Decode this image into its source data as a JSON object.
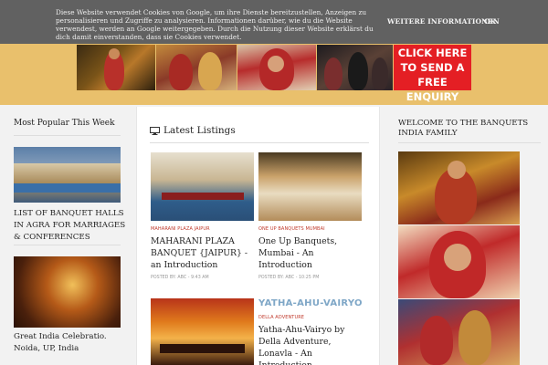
{
  "cookie": {
    "text": "Diese Website verwendet Cookies von Google, um ihre Dienste bereitzustellen, Anzeigen zu personalisieren und Zugriffe zu analysieren. Informationen darüber, wie du die Website verwendest, werden an Google weitergegeben. Durch die Nutzung dieser Website erklärst du dich damit einverstanden, dass sie Cookies verwendet.",
    "more_label": "WEITERE INFORMATIONEN",
    "ok_label": "OK"
  },
  "banner": {
    "enquiry_lines": [
      "CLICK HERE",
      "TO SEND A",
      "FREE ENQUIRY"
    ]
  },
  "left": {
    "title": "Most Popular This Week",
    "items": [
      {
        "title": "LIST OF BANQUET HALLS IN AGRA FOR MARRIAGES & CONFERENCES"
      },
      {
        "title": "Great India Celebratio. Noida, UP, India"
      }
    ]
  },
  "main": {
    "title": "Latest Listings",
    "listings": [
      {
        "category": "MAHARANI PLAZA JAIPUR",
        "title": "MAHARANI PLAZA BANQUET {JAIPUR} - an Introduction",
        "meta": "POSTED BY: ABC - 9:43 AM"
      },
      {
        "category": "ONE UP BANQUETS MUMBAI",
        "title": "One Up Banquets, Mumbai - An Introduction",
        "meta": "POSTED BY: ABC - 10:25 PM"
      },
      {
        "category": "DELLA ADVENTURE",
        "title": "Yatha-Ahu-Vairyo by Della Adventure, Lonavla - An Introduction",
        "logo": "YATHA-AHU-VAIRYO"
      }
    ]
  },
  "right": {
    "title": "WELCOME TO THE BANQUETS INDIA FAMILY"
  },
  "colors": {
    "header_band": "#e9c06c",
    "cookie_bar": "#616161",
    "enquiry_red": "#e41f24",
    "category_red": "#c0392b"
  }
}
